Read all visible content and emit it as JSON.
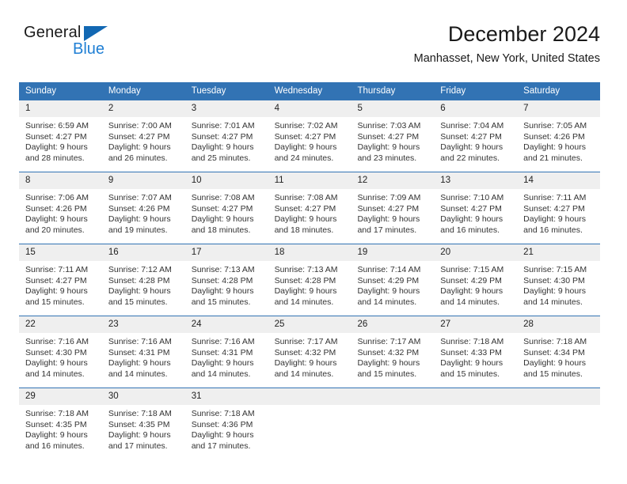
{
  "brand": {
    "name_top": "General",
    "name_bottom": "Blue",
    "triangle_color": "#1268b3",
    "blue_text_color": "#1f7fd4"
  },
  "header": {
    "title": "December 2024",
    "subtitle": "Manhasset, New York, United States"
  },
  "theme": {
    "header_blue": "#3273b4",
    "daynum_gray": "#efefef",
    "text_color": "#333333"
  },
  "weekdays": [
    "Sunday",
    "Monday",
    "Tuesday",
    "Wednesday",
    "Thursday",
    "Friday",
    "Saturday"
  ],
  "weeks": [
    [
      {
        "day": "1",
        "sunrise": "Sunrise: 6:59 AM",
        "sunset": "Sunset: 4:27 PM",
        "daylight1": "Daylight: 9 hours",
        "daylight2": "and 28 minutes."
      },
      {
        "day": "2",
        "sunrise": "Sunrise: 7:00 AM",
        "sunset": "Sunset: 4:27 PM",
        "daylight1": "Daylight: 9 hours",
        "daylight2": "and 26 minutes."
      },
      {
        "day": "3",
        "sunrise": "Sunrise: 7:01 AM",
        "sunset": "Sunset: 4:27 PM",
        "daylight1": "Daylight: 9 hours",
        "daylight2": "and 25 minutes."
      },
      {
        "day": "4",
        "sunrise": "Sunrise: 7:02 AM",
        "sunset": "Sunset: 4:27 PM",
        "daylight1": "Daylight: 9 hours",
        "daylight2": "and 24 minutes."
      },
      {
        "day": "5",
        "sunrise": "Sunrise: 7:03 AM",
        "sunset": "Sunset: 4:27 PM",
        "daylight1": "Daylight: 9 hours",
        "daylight2": "and 23 minutes."
      },
      {
        "day": "6",
        "sunrise": "Sunrise: 7:04 AM",
        "sunset": "Sunset: 4:27 PM",
        "daylight1": "Daylight: 9 hours",
        "daylight2": "and 22 minutes."
      },
      {
        "day": "7",
        "sunrise": "Sunrise: 7:05 AM",
        "sunset": "Sunset: 4:26 PM",
        "daylight1": "Daylight: 9 hours",
        "daylight2": "and 21 minutes."
      }
    ],
    [
      {
        "day": "8",
        "sunrise": "Sunrise: 7:06 AM",
        "sunset": "Sunset: 4:26 PM",
        "daylight1": "Daylight: 9 hours",
        "daylight2": "and 20 minutes."
      },
      {
        "day": "9",
        "sunrise": "Sunrise: 7:07 AM",
        "sunset": "Sunset: 4:26 PM",
        "daylight1": "Daylight: 9 hours",
        "daylight2": "and 19 minutes."
      },
      {
        "day": "10",
        "sunrise": "Sunrise: 7:08 AM",
        "sunset": "Sunset: 4:27 PM",
        "daylight1": "Daylight: 9 hours",
        "daylight2": "and 18 minutes."
      },
      {
        "day": "11",
        "sunrise": "Sunrise: 7:08 AM",
        "sunset": "Sunset: 4:27 PM",
        "daylight1": "Daylight: 9 hours",
        "daylight2": "and 18 minutes."
      },
      {
        "day": "12",
        "sunrise": "Sunrise: 7:09 AM",
        "sunset": "Sunset: 4:27 PM",
        "daylight1": "Daylight: 9 hours",
        "daylight2": "and 17 minutes."
      },
      {
        "day": "13",
        "sunrise": "Sunrise: 7:10 AM",
        "sunset": "Sunset: 4:27 PM",
        "daylight1": "Daylight: 9 hours",
        "daylight2": "and 16 minutes."
      },
      {
        "day": "14",
        "sunrise": "Sunrise: 7:11 AM",
        "sunset": "Sunset: 4:27 PM",
        "daylight1": "Daylight: 9 hours",
        "daylight2": "and 16 minutes."
      }
    ],
    [
      {
        "day": "15",
        "sunrise": "Sunrise: 7:11 AM",
        "sunset": "Sunset: 4:27 PM",
        "daylight1": "Daylight: 9 hours",
        "daylight2": "and 15 minutes."
      },
      {
        "day": "16",
        "sunrise": "Sunrise: 7:12 AM",
        "sunset": "Sunset: 4:28 PM",
        "daylight1": "Daylight: 9 hours",
        "daylight2": "and 15 minutes."
      },
      {
        "day": "17",
        "sunrise": "Sunrise: 7:13 AM",
        "sunset": "Sunset: 4:28 PM",
        "daylight1": "Daylight: 9 hours",
        "daylight2": "and 15 minutes."
      },
      {
        "day": "18",
        "sunrise": "Sunrise: 7:13 AM",
        "sunset": "Sunset: 4:28 PM",
        "daylight1": "Daylight: 9 hours",
        "daylight2": "and 14 minutes."
      },
      {
        "day": "19",
        "sunrise": "Sunrise: 7:14 AM",
        "sunset": "Sunset: 4:29 PM",
        "daylight1": "Daylight: 9 hours",
        "daylight2": "and 14 minutes."
      },
      {
        "day": "20",
        "sunrise": "Sunrise: 7:15 AM",
        "sunset": "Sunset: 4:29 PM",
        "daylight1": "Daylight: 9 hours",
        "daylight2": "and 14 minutes."
      },
      {
        "day": "21",
        "sunrise": "Sunrise: 7:15 AM",
        "sunset": "Sunset: 4:30 PM",
        "daylight1": "Daylight: 9 hours",
        "daylight2": "and 14 minutes."
      }
    ],
    [
      {
        "day": "22",
        "sunrise": "Sunrise: 7:16 AM",
        "sunset": "Sunset: 4:30 PM",
        "daylight1": "Daylight: 9 hours",
        "daylight2": "and 14 minutes."
      },
      {
        "day": "23",
        "sunrise": "Sunrise: 7:16 AM",
        "sunset": "Sunset: 4:31 PM",
        "daylight1": "Daylight: 9 hours",
        "daylight2": "and 14 minutes."
      },
      {
        "day": "24",
        "sunrise": "Sunrise: 7:16 AM",
        "sunset": "Sunset: 4:31 PM",
        "daylight1": "Daylight: 9 hours",
        "daylight2": "and 14 minutes."
      },
      {
        "day": "25",
        "sunrise": "Sunrise: 7:17 AM",
        "sunset": "Sunset: 4:32 PM",
        "daylight1": "Daylight: 9 hours",
        "daylight2": "and 14 minutes."
      },
      {
        "day": "26",
        "sunrise": "Sunrise: 7:17 AM",
        "sunset": "Sunset: 4:32 PM",
        "daylight1": "Daylight: 9 hours",
        "daylight2": "and 15 minutes."
      },
      {
        "day": "27",
        "sunrise": "Sunrise: 7:18 AM",
        "sunset": "Sunset: 4:33 PM",
        "daylight1": "Daylight: 9 hours",
        "daylight2": "and 15 minutes."
      },
      {
        "day": "28",
        "sunrise": "Sunrise: 7:18 AM",
        "sunset": "Sunset: 4:34 PM",
        "daylight1": "Daylight: 9 hours",
        "daylight2": "and 15 minutes."
      }
    ],
    [
      {
        "day": "29",
        "sunrise": "Sunrise: 7:18 AM",
        "sunset": "Sunset: 4:35 PM",
        "daylight1": "Daylight: 9 hours",
        "daylight2": "and 16 minutes."
      },
      {
        "day": "30",
        "sunrise": "Sunrise: 7:18 AM",
        "sunset": "Sunset: 4:35 PM",
        "daylight1": "Daylight: 9 hours",
        "daylight2": "and 17 minutes."
      },
      {
        "day": "31",
        "sunrise": "Sunrise: 7:18 AM",
        "sunset": "Sunset: 4:36 PM",
        "daylight1": "Daylight: 9 hours",
        "daylight2": "and 17 minutes."
      },
      {
        "day": "",
        "sunrise": "",
        "sunset": "",
        "daylight1": "",
        "daylight2": ""
      },
      {
        "day": "",
        "sunrise": "",
        "sunset": "",
        "daylight1": "",
        "daylight2": ""
      },
      {
        "day": "",
        "sunrise": "",
        "sunset": "",
        "daylight1": "",
        "daylight2": ""
      },
      {
        "day": "",
        "sunrise": "",
        "sunset": "",
        "daylight1": "",
        "daylight2": ""
      }
    ]
  ]
}
